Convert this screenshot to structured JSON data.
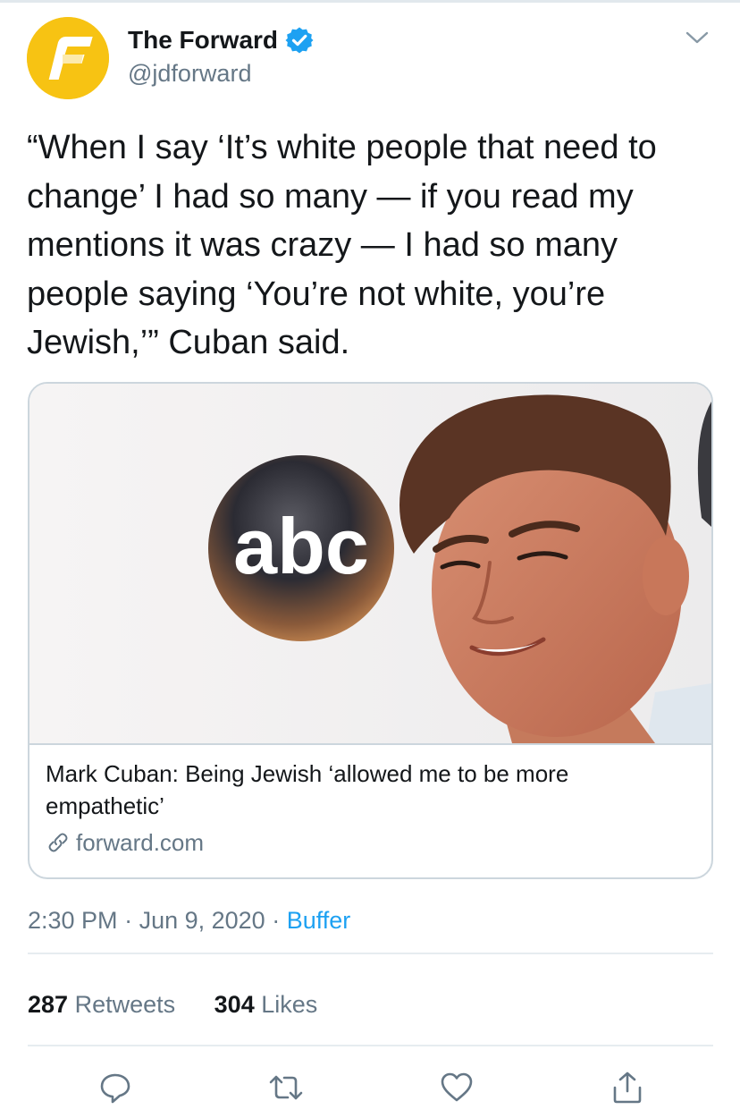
{
  "author": {
    "name": "The Forward",
    "handle": "@jdforward",
    "verified": true,
    "avatar_color": "#f7c313"
  },
  "tweet": {
    "text": "“When I say ‘It’s white people that need to change’ I had so many — if you read my mentions it was crazy — I had so many people saying ‘You’re not white, you’re Jewish,’” Cuban said."
  },
  "card": {
    "title": "Mark Cuban: Being Jewish ‘allowed me to be more empathetic’",
    "domain": "forward.com",
    "image_logo_text": "abc"
  },
  "meta": {
    "time": "2:30 PM",
    "separator": " · ",
    "date": "Jun 9, 2020",
    "source": "Buffer"
  },
  "stats": {
    "retweets_count": "287",
    "retweets_label": "Retweets",
    "likes_count": "304",
    "likes_label": "Likes"
  },
  "icons": {
    "menu": "chevron-down-icon",
    "reply": "reply-icon",
    "retweet": "retweet-icon",
    "like": "heart-icon",
    "share": "share-icon"
  },
  "colors": {
    "accent": "#1da1f2",
    "text": "#14171a",
    "muted": "#657786"
  }
}
